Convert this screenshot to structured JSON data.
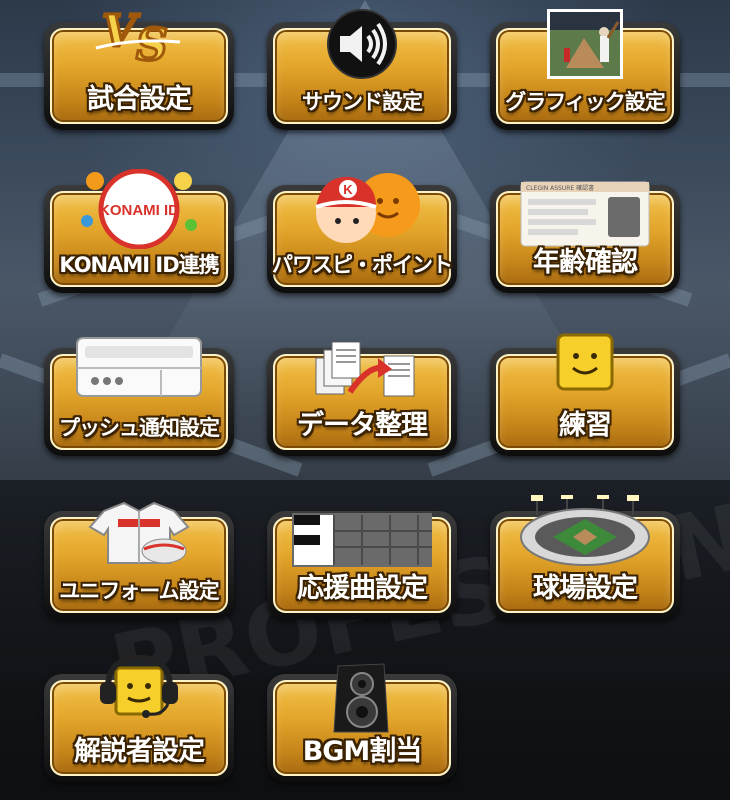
{
  "menu": {
    "tiles": [
      {
        "label": "試合設定",
        "icon": "vs-icon"
      },
      {
        "label": "サウンド設定",
        "icon": "speaker-icon"
      },
      {
        "label": "グラフィック設定",
        "icon": "baseball-photo-icon"
      },
      {
        "label": "KONAMI ID連携",
        "icon": "konami-id-icon",
        "icon_text": "KONAMI ID"
      },
      {
        "label": "パワスピ・ポイント",
        "icon": "pawapuro-character-icon"
      },
      {
        "label": "年齢確認",
        "icon": "id-card-icon",
        "icon_text": "CLEGIN ASSURE 確認書"
      },
      {
        "label": "プッシュ通知設定",
        "icon": "notification-panel-icon"
      },
      {
        "label": "データ整理",
        "icon": "data-transfer-icon"
      },
      {
        "label": "練習",
        "icon": "smiley-block-icon"
      },
      {
        "label": "ユニフォーム設定",
        "icon": "uniform-icon"
      },
      {
        "label": "応援曲設定",
        "icon": "piano-keys-icon"
      },
      {
        "label": "球場設定",
        "icon": "stadium-icon"
      },
      {
        "label": "解説者設定",
        "icon": "commentator-headset-icon"
      },
      {
        "label": "BGM割当",
        "icon": "loudspeaker-icon"
      }
    ]
  },
  "colors": {
    "tile_gold": "#e3a52a",
    "tile_frame": "#1a1a1a",
    "label_outline": "#3b2200",
    "accent_orange": "#f39a1a",
    "accent_red": "#d8322a"
  }
}
